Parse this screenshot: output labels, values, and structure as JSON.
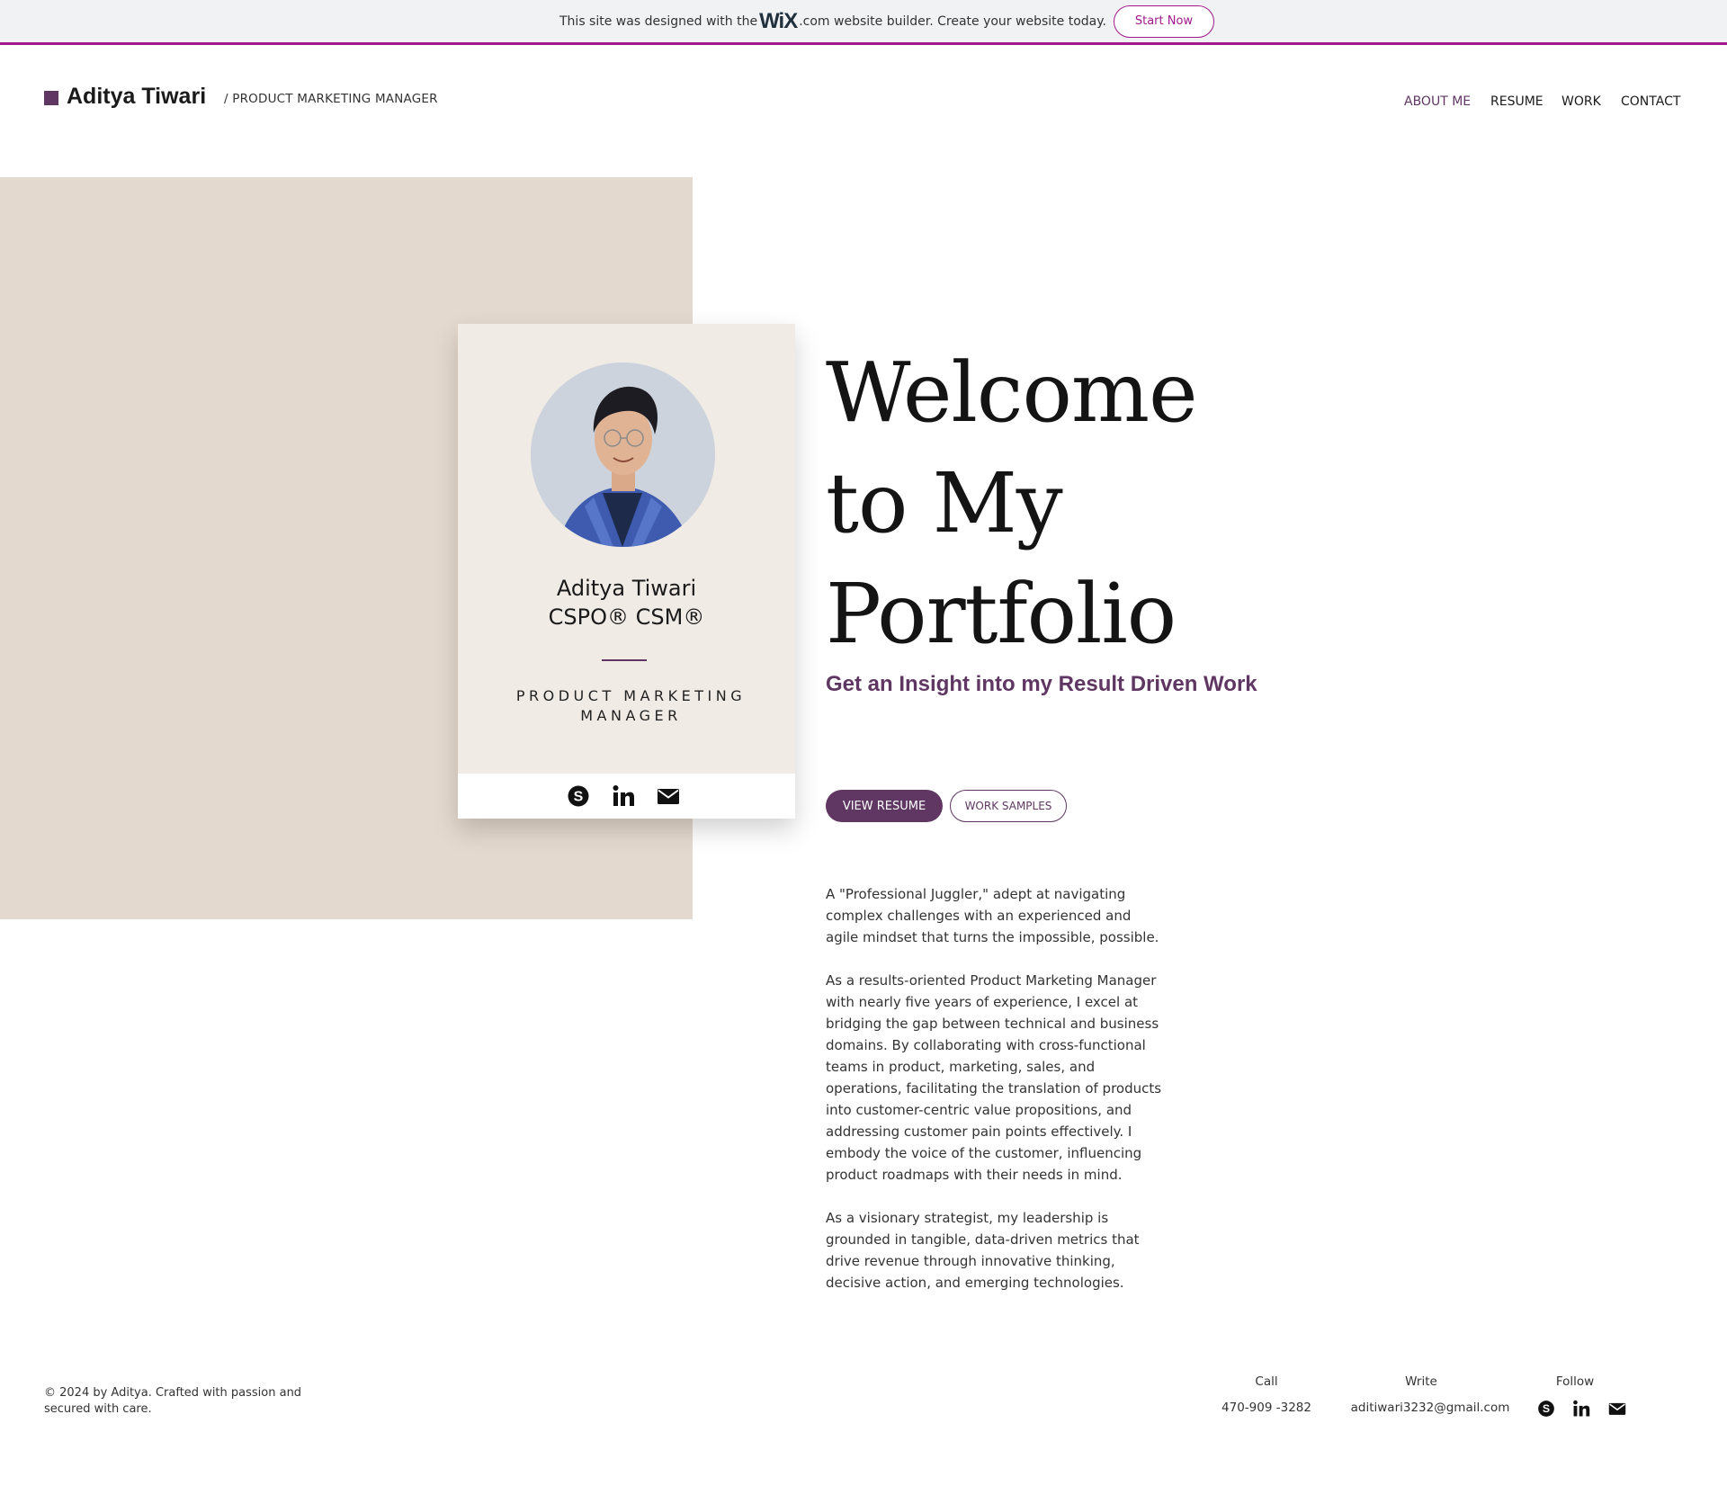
{
  "banner": {
    "text_before": "This site was designed with the",
    "brand": "WiX",
    "text_after": ".com website builder. Create your website today.",
    "cta": "Start Now",
    "accent_color": "#a1198b"
  },
  "header": {
    "name": "Aditya Tiwari",
    "role": "/ PRODUCT MARKETING MANAGER",
    "nav": [
      {
        "label": "ABOUT ME",
        "active": true
      },
      {
        "label": "RESUME",
        "active": false
      },
      {
        "label": "WORK",
        "active": false
      },
      {
        "label": "CONTACT",
        "active": false
      }
    ]
  },
  "card": {
    "name": "Aditya Tiwari",
    "certs": "CSPO® CSM®",
    "role": "PRODUCT MARKETING MANAGER",
    "social_icons": [
      "skype-icon",
      "linkedin-icon",
      "mail-icon"
    ]
  },
  "hero": {
    "title_lines": [
      "Welcome",
      "to My",
      "Portfolio"
    ],
    "tagline": "Get an Insight into my Result Driven Work",
    "view_resume": "VIEW RESUME",
    "work_samples": "WORK SAMPLES",
    "paragraphs": [
      "A \"Professional Juggler,\" adept at navigating complex challenges with an experienced and agile mindset that turns the impossible, possible.",
      "As a results-oriented Product Marketing Manager with nearly five years of experience, I excel at bridging the gap between technical and business domains. By collaborating with cross-functional teams in product, marketing, sales, and operations, facilitating the translation of products into customer-centric value propositions, and addressing customer pain points effectively. I embody the voice of the customer, influencing product roadmaps with their needs in mind.",
      "As a visionary strategist, my leadership is grounded in tangible, data-driven metrics that drive revenue through innovative thinking, decisive action, and emerging technologies."
    ]
  },
  "footer": {
    "copyright": "© 2024 by Aditya. Crafted with passion and secured with care.",
    "call_label": "Call",
    "call_value": "470-909 -3282",
    "write_label": "Write",
    "write_value": "aditiwari3232@gmail.com",
    "follow_label": "Follow"
  },
  "colors": {
    "brand_purple": "#5f3762",
    "beige": "#e4d9ce",
    "card_bg": "#f1ebe6"
  }
}
